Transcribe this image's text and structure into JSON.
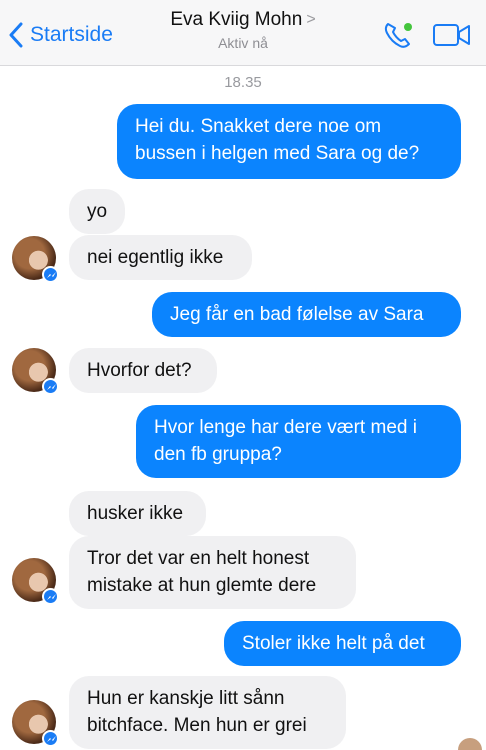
{
  "header": {
    "back_label": "Startside",
    "contact_name": "Eva Kviig Mohn",
    "chevron": ">",
    "status": "Aktiv nå"
  },
  "timestamp": "18.35",
  "messages": [
    {
      "direction": "out",
      "lines": [
        "Hei du. Snakket dere noe om",
        "bussen i helgen med Sara og de?"
      ]
    },
    {
      "direction": "in",
      "lines": [
        "yo"
      ]
    },
    {
      "direction": "in",
      "lines": [
        "nei egentlig ikke"
      ]
    },
    {
      "direction": "out",
      "lines": [
        "Jeg får en bad følelse av Sara"
      ]
    },
    {
      "direction": "in",
      "lines": [
        "Hvorfor det?"
      ]
    },
    {
      "direction": "out",
      "lines": [
        "Hvor lenge har dere vært med i",
        "den fb gruppa?"
      ]
    },
    {
      "direction": "in",
      "lines": [
        "husker ikke"
      ]
    },
    {
      "direction": "in",
      "lines": [
        "Tror det var en helt honest",
        "mistake at hun glemte dere"
      ]
    },
    {
      "direction": "out",
      "lines": [
        "Stoler ikke helt på det"
      ]
    },
    {
      "direction": "in",
      "lines": [
        "Hun er kanskje litt sånn",
        "bitchface. Men hun er grei"
      ]
    }
  ],
  "icons": {
    "back": "chevron-left-icon",
    "call": "phone-icon",
    "video": "video-camera-icon",
    "badge": "messenger-icon"
  },
  "colors": {
    "accent": "#1a7cf5",
    "outgoing_bubble": "#0b84fe",
    "incoming_bubble": "#f0f0f2",
    "online": "#44c53d"
  }
}
